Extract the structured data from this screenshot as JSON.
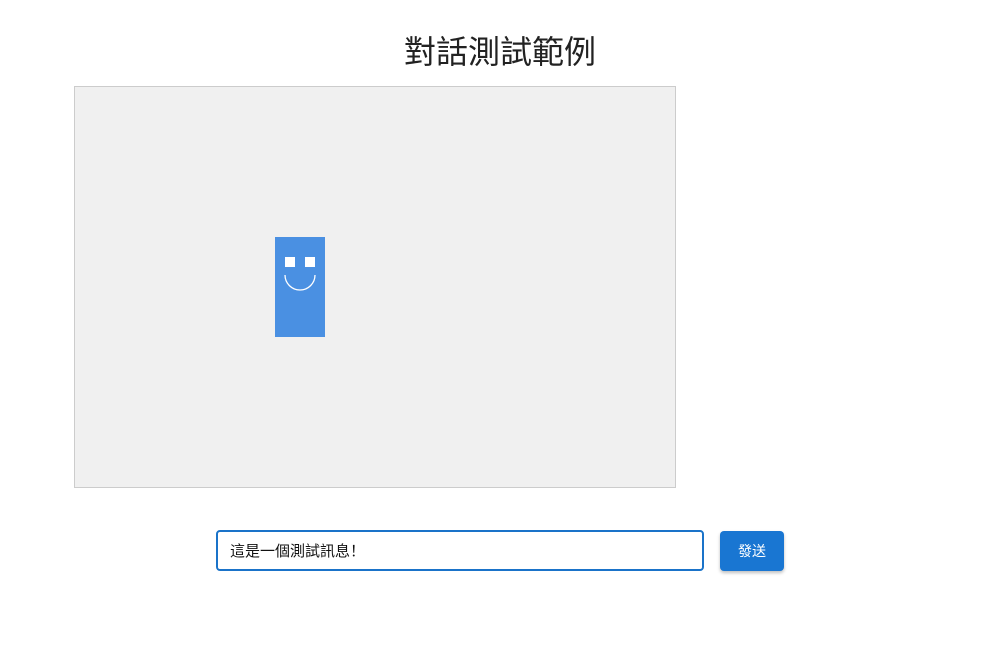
{
  "page": {
    "title": "對話測試範例"
  },
  "stage": {
    "background_color": "#f0f0f0",
    "character": {
      "body_color": "#4a90e2",
      "eye_color": "#ffffff",
      "icons": [
        "robot-icon"
      ]
    }
  },
  "chat": {
    "input_value": "這是一個測試訊息！",
    "send_label": "發送",
    "accent_color": "#1976d2"
  }
}
